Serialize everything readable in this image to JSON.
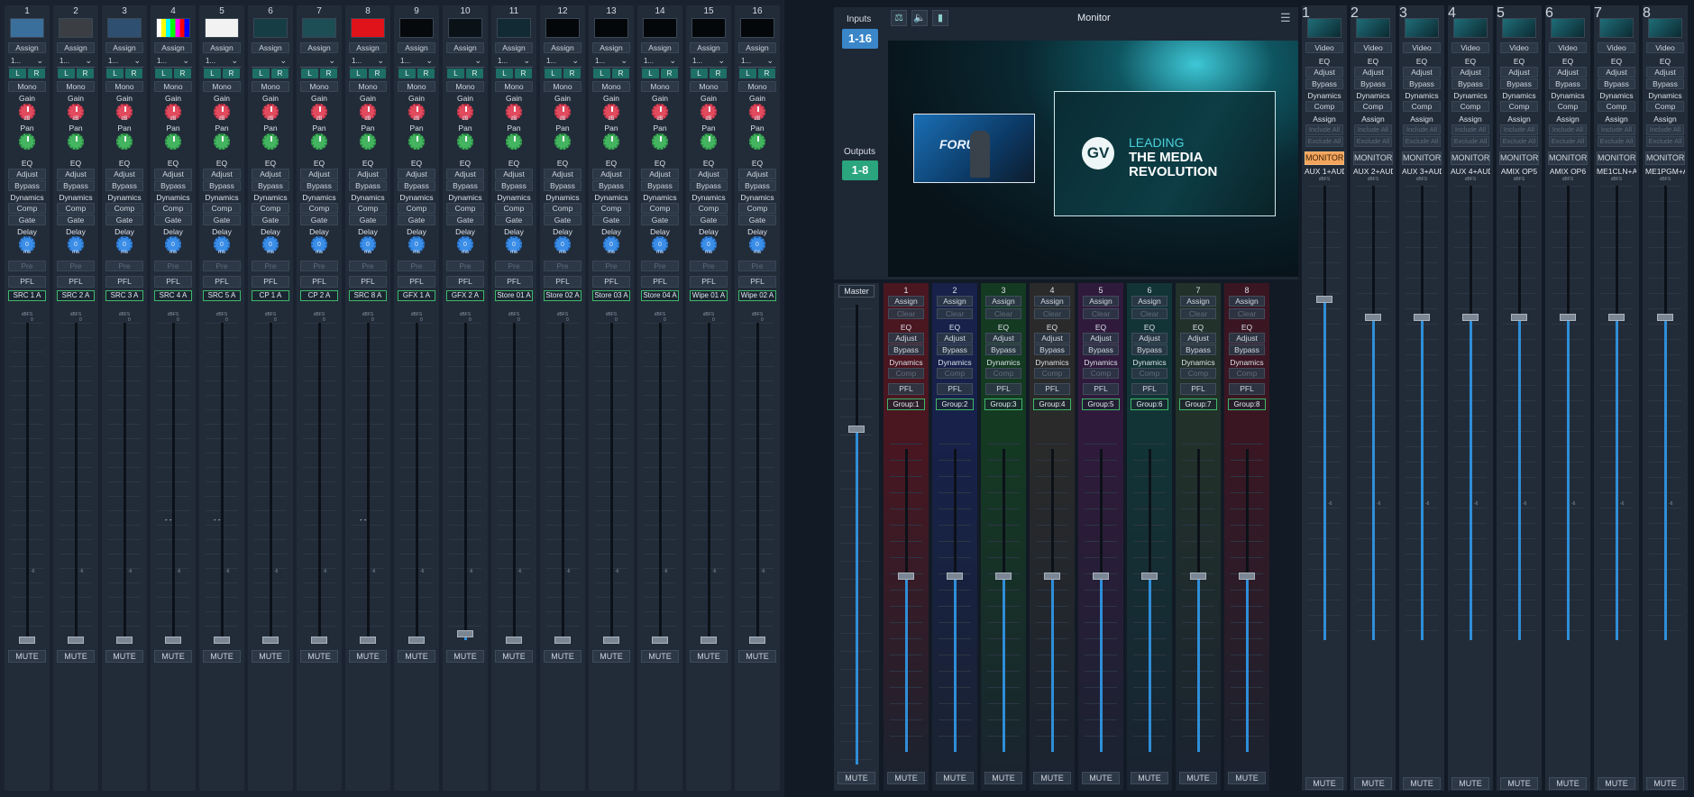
{
  "common": {
    "assign": "Assign",
    "mono": "Mono",
    "gain": "Gain",
    "pan": "Pan",
    "eq": "EQ",
    "adjust": "Adjust",
    "bypass": "Bypass",
    "dynamics": "Dynamics",
    "comp": "Comp",
    "gate": "Gate",
    "delay": "Delay",
    "ms": "ms",
    "db": "dB",
    "pre": "Pre",
    "pfl": "PFL",
    "dbfs": "dBFS",
    "zero": "0",
    "minus_six": "-6",
    "mute": "MUTE",
    "left": "L",
    "right": "R",
    "clear": "Clear",
    "video": "Video",
    "include_all": "Include All",
    "exclude_all": "Exclude All",
    "monitor": "MONITOR",
    "dash": "- -"
  },
  "input_strips": [
    {
      "num": "1",
      "name": "SRC 1 A",
      "select": "1...",
      "thumb": "#3a6f9c",
      "level": 0
    },
    {
      "num": "2",
      "name": "SRC 2 A",
      "select": "1...",
      "thumb": "#3b3f44",
      "level": 0
    },
    {
      "num": "3",
      "name": "SRC 3 A",
      "select": "1...",
      "thumb": "#2f4f70",
      "level": 0
    },
    {
      "num": "4",
      "name": "SRC 4 A",
      "select": "1...",
      "thumb": "bars",
      "level": 0
    },
    {
      "num": "5",
      "name": "SRC 5 A",
      "select": "1...",
      "thumb": "#f2f2f2",
      "level": 0
    },
    {
      "num": "6",
      "name": "CP 1 A",
      "select": "",
      "thumb": "#163c44",
      "level": 0
    },
    {
      "num": "7",
      "name": "CP 2 A",
      "select": "",
      "thumb": "#1d4d55",
      "level": 0
    },
    {
      "num": "8",
      "name": "SRC 8 A",
      "select": "1...",
      "thumb": "#e0121a",
      "level": 0
    },
    {
      "num": "9",
      "name": "GFX 1 A",
      "select": "1...",
      "thumb": "#06090c",
      "level": 0
    },
    {
      "num": "10",
      "name": "GFX 2 A",
      "select": "",
      "thumb": "#0a1218",
      "level": 0.02
    },
    {
      "num": "11",
      "name": "Store 01 A",
      "select": "1...",
      "thumb": "#112a33",
      "level": 0
    },
    {
      "num": "12",
      "name": "Store 02 A",
      "select": "1...",
      "thumb": "#04070a",
      "level": 0
    },
    {
      "num": "13",
      "name": "Store 03 A",
      "select": "1...",
      "thumb": "#04070a",
      "level": 0
    },
    {
      "num": "14",
      "name": "Store 04 A",
      "select": "1...",
      "thumb": "#04070a",
      "level": 0
    },
    {
      "num": "15",
      "name": "Wipe 01 A",
      "select": "1...",
      "thumb": "#04070a",
      "level": 0
    },
    {
      "num": "16",
      "name": "Wipe 02 A",
      "select": "1...",
      "thumb": "#04070a",
      "level": 0
    }
  ],
  "monitor": {
    "title": "Monitor",
    "inputs_label": "Inputs",
    "inputs_value": "1-16",
    "outputs_label": "Outputs",
    "outputs_value": "1-8",
    "slide_text_1": "LEADING",
    "slide_text_2": "THE MEDIA",
    "slide_text_3": "REVOLUTION",
    "logo_text": "GV",
    "pip_text": "FORU",
    "colors": {
      "accent": "#3a86c9",
      "outputs": "#2aa57d"
    }
  },
  "master": {
    "label": "Master",
    "level": 0.73
  },
  "groups": [
    {
      "num": "1",
      "name": "Group:1",
      "tint": "#4a1620"
    },
    {
      "num": "2",
      "name": "Group:2",
      "tint": "#17214a"
    },
    {
      "num": "3",
      "name": "Group:3",
      "tint": "#143a22"
    },
    {
      "num": "4",
      "name": "Group:4",
      "tint": "#2a2a2a"
    },
    {
      "num": "5",
      "name": "Group:5",
      "tint": "#301a3c"
    },
    {
      "num": "6",
      "name": "Group:6",
      "tint": "#123436"
    },
    {
      "num": "7",
      "name": "Group:7",
      "tint": "#22312a"
    },
    {
      "num": "8",
      "name": "Group:8",
      "tint": "#3a1622"
    }
  ],
  "group_level": 0.58,
  "outputs": [
    {
      "num": "1",
      "name": "AUX 1+AUD",
      "monitor_active": true,
      "level": 0.75
    },
    {
      "num": "2",
      "name": "AUX 2+AUD",
      "monitor_active": false,
      "level": 0.71
    },
    {
      "num": "3",
      "name": "AUX 3+AUD",
      "monitor_active": false,
      "level": 0.71
    },
    {
      "num": "4",
      "name": "AUX 4+AUD",
      "monitor_active": false,
      "level": 0.71
    },
    {
      "num": "5",
      "name": "AMIX OP5",
      "monitor_active": false,
      "level": 0.71
    },
    {
      "num": "6",
      "name": "AMIX OP6",
      "monitor_active": false,
      "level": 0.71
    },
    {
      "num": "7",
      "name": "ME1CLN+A",
      "monitor_active": false,
      "level": 0.71
    },
    {
      "num": "8",
      "name": "ME1PGM+A",
      "monitor_active": false,
      "level": 0.71
    }
  ]
}
